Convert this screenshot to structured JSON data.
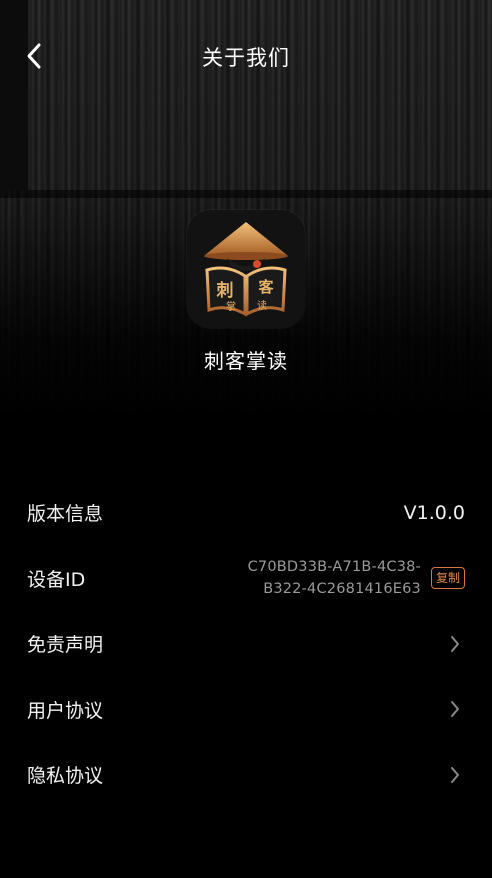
{
  "header": {
    "title": "关于我们",
    "back_icon": "chevron-left-icon"
  },
  "app": {
    "name": "刺客掌读",
    "icon_text_top_left": "刺",
    "icon_text_top_right": "客",
    "icon_text_bottom_left": "掌",
    "icon_text_bottom_right": "读",
    "accent_color": "#c9893f"
  },
  "list": {
    "version_label": "版本信息",
    "version_value": "V1.0.0",
    "device_label": "设备ID",
    "device_id_line1": "C70BD33B-A71B-4C38-",
    "device_id_line2": "B322-4C2681416E63",
    "copy_label": "复制",
    "disclaimer_label": "免责声明",
    "user_agreement_label": "用户协议",
    "privacy_label": "隐私协议"
  },
  "colors": {
    "background": "#000000",
    "text": "#f2f2f2",
    "muted": "#9a9a9a",
    "copy_accent": "#e08a4a"
  }
}
